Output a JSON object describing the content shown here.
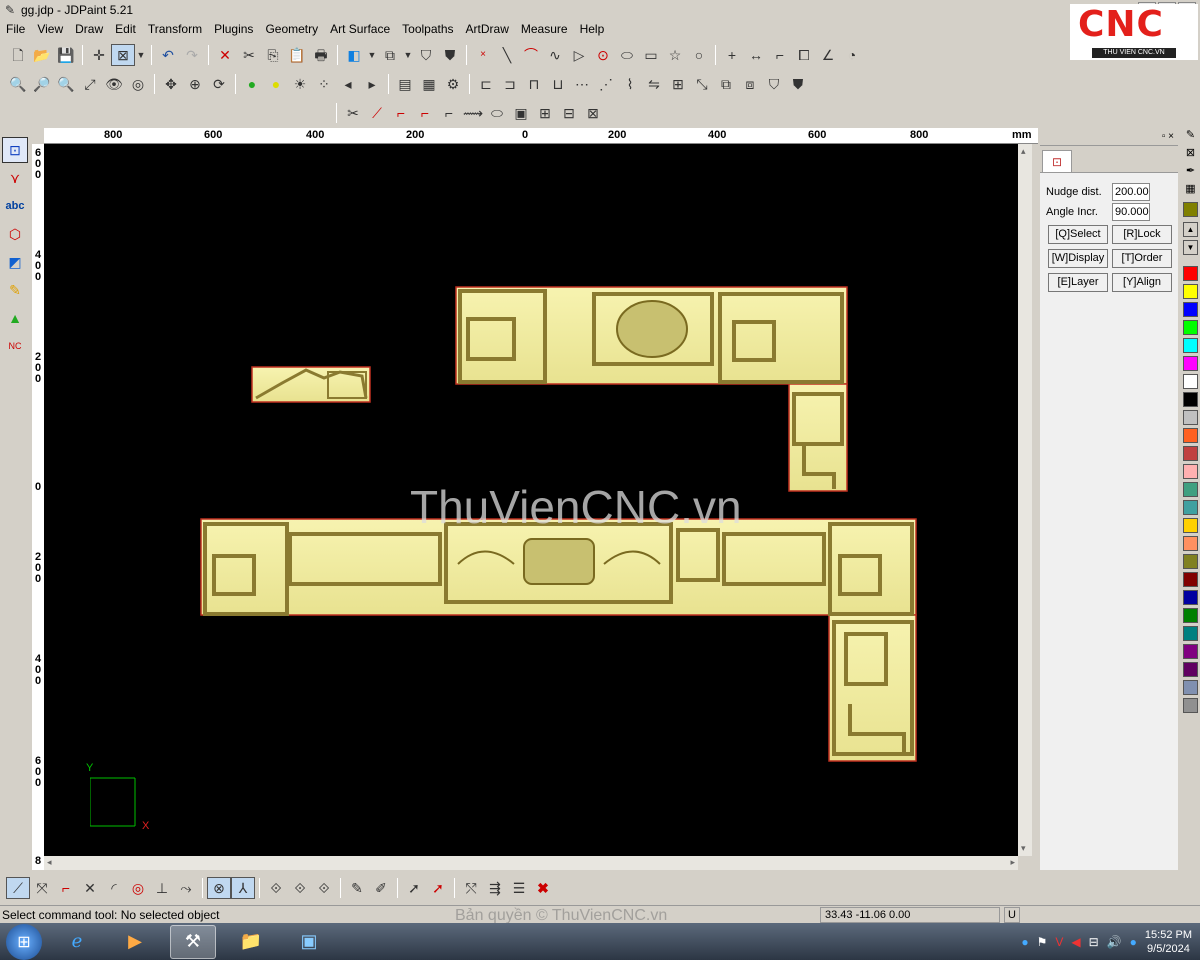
{
  "window": {
    "title": "gg.jdp - JDPaint 5.21"
  },
  "menu": [
    "File",
    "View",
    "Draw",
    "Edit",
    "Transform",
    "Plugins",
    "Geometry",
    "Art Surface",
    "Toolpaths",
    "ArtDraw",
    "Measure",
    "Help"
  ],
  "logo": {
    "text": "CNC",
    "sub": "THU VIEN CNC.VN"
  },
  "ruler_h": {
    "labels": [
      "800",
      "600",
      "400",
      "200",
      "0",
      "200",
      "400",
      "600",
      "800"
    ],
    "unit": "mm"
  },
  "ruler_v": {
    "labels": [
      "600",
      "400",
      "200",
      "0",
      "200",
      "400",
      "600",
      "8"
    ]
  },
  "canvas": {
    "watermark": "ThuVienCNC.vn",
    "axis_x": "X",
    "axis_y": "Y"
  },
  "right_panel": {
    "nudge_label": "Nudge dist.",
    "nudge_value": "200.000",
    "angle_label": "Angle Incr.",
    "angle_value": "90.000",
    "buttons": [
      "[Q]Select",
      "[R]Lock",
      "[W]Display",
      "[T]Order",
      "[E]Layer",
      "[Y]Align"
    ]
  },
  "palette": [
    "#808000",
    "#ff0000",
    "#ffff00",
    "#0000ff",
    "#00ff00",
    "#00ffff",
    "#ff00ff",
    "#ffffff",
    "#000000",
    "#c0c0c0",
    "#ff6020",
    "#c04040",
    "#ffb0b0",
    "#40a080",
    "#40a0a0",
    "#ffd000",
    "#ff9060",
    "#808020",
    "#800000",
    "#0000a0",
    "#008000",
    "#008080",
    "#800080",
    "#600060",
    "#8090b0",
    "#909090"
  ],
  "status": {
    "text": "Select command tool: No selected object",
    "copyright": "Bản quyền © ThuVienCNC.vn",
    "coords": "33.43 -11.06 0.00",
    "unit": "U"
  },
  "taskbar": {
    "time": "15:52 PM",
    "date": "9/5/2024"
  }
}
